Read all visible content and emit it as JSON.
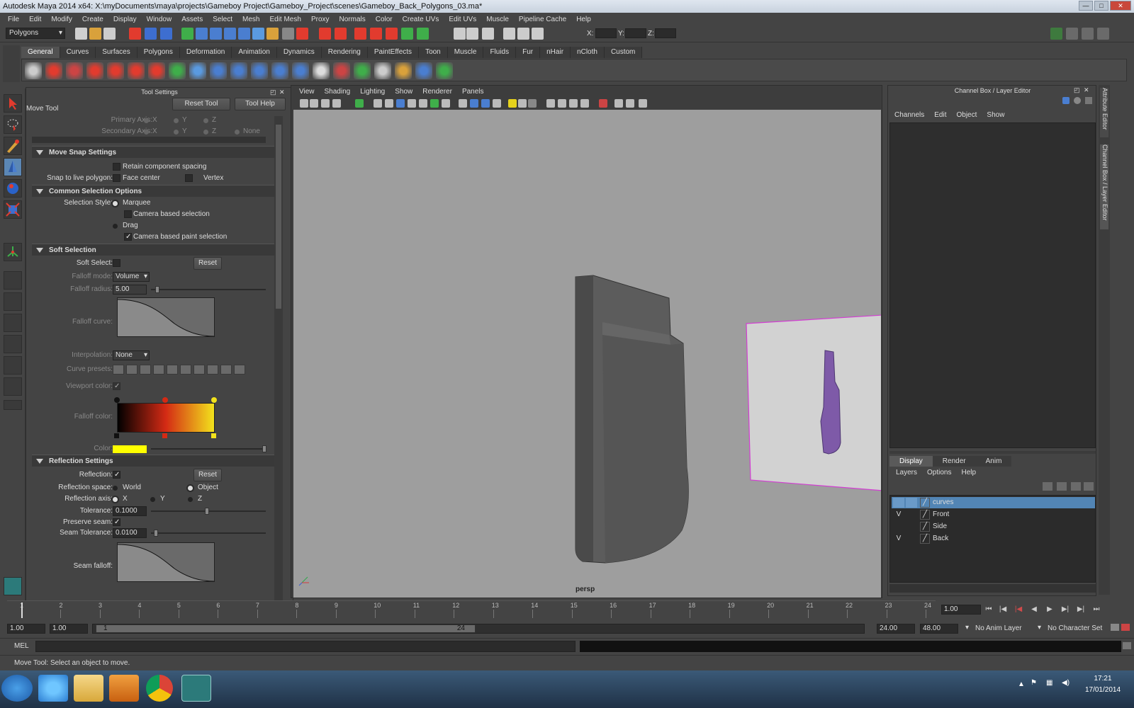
{
  "window": {
    "title": "Autodesk Maya 2014 x64: X:\\myDocuments\\maya\\projects\\Gameboy Project\\Gameboy_Project\\scenes\\Gameboy_Back_Polygons_03.ma*"
  },
  "menubar": [
    "File",
    "Edit",
    "Modify",
    "Create",
    "Display",
    "Window",
    "Assets",
    "Select",
    "Mesh",
    "Edit Mesh",
    "Proxy",
    "Normals",
    "Color",
    "Create UVs",
    "Edit UVs",
    "Muscle",
    "Pipeline Cache",
    "Help"
  ],
  "statusline": {
    "mode": "Polygons",
    "x_label": "X:",
    "y_label": "Y:",
    "z_label": "Z:"
  },
  "shelf_tabs": [
    "General",
    "Curves",
    "Surfaces",
    "Polygons",
    "Deformation",
    "Animation",
    "Dynamics",
    "Rendering",
    "PaintEffects",
    "Toon",
    "Muscle",
    "Fluids",
    "Fur",
    "nHair",
    "nCloth",
    "Custom"
  ],
  "tool_settings": {
    "panel_title": "Tool Settings",
    "tool_name": "Move Tool",
    "reset_tool": "Reset Tool",
    "tool_help": "Tool Help",
    "primary_axis": "Primary Axis:",
    "secondary_axis": "Secondary Axis:",
    "axis_x": "X",
    "axis_y": "Y",
    "axis_z": "Z",
    "axis_none": "None",
    "move_snap": {
      "title": "Move Snap Settings",
      "retain": "Retain component spacing",
      "snap_label": "Snap to live polygon:",
      "face_center": "Face center",
      "vertex": "Vertex"
    },
    "common_selection": {
      "title": "Common Selection Options",
      "style_label": "Selection Style:",
      "marquee": "Marquee",
      "camera_based": "Camera based selection",
      "drag": "Drag",
      "camera_paint": "Camera based paint selection"
    },
    "soft_selection": {
      "title": "Soft Selection",
      "soft_select": "Soft Select:",
      "reset": "Reset",
      "falloff_mode": "Falloff mode:",
      "falloff_mode_val": "Volume",
      "falloff_radius": "Falloff radius:",
      "falloff_radius_val": "5.00",
      "falloff_curve": "Falloff curve:",
      "interpolation": "Interpolation:",
      "interpolation_val": "None",
      "curve_presets": "Curve presets:",
      "viewport_color": "Viewport color:",
      "falloff_color": "Falloff color:",
      "color": "Color:"
    },
    "reflection": {
      "title": "Reflection Settings",
      "reflection": "Reflection:",
      "reset": "Reset",
      "space_label": "Reflection space:",
      "world": "World",
      "object": "Object",
      "axis_label": "Reflection axis:",
      "x": "X",
      "y": "Y",
      "z": "Z",
      "tolerance": "Tolerance:",
      "tolerance_val": "0.1000",
      "preserve_seam": "Preserve seam:",
      "seam_tolerance": "Seam Tolerance:",
      "seam_tolerance_val": "0.0100",
      "seam_falloff": "Seam falloff:"
    }
  },
  "viewport": {
    "menus": [
      "View",
      "Shading",
      "Lighting",
      "Show",
      "Renderer",
      "Panels"
    ],
    "camera": "persp"
  },
  "channel_box": {
    "title": "Channel Box / Layer Editor",
    "menus": [
      "Channels",
      "Edit",
      "Object",
      "Show"
    ]
  },
  "layer_editor": {
    "tabs": [
      "Display",
      "Render",
      "Anim"
    ],
    "menus": [
      "Layers",
      "Options",
      "Help"
    ],
    "layers": [
      {
        "v": "",
        "name": "curves"
      },
      {
        "v": "V",
        "name": "Front"
      },
      {
        "v": "",
        "name": "Side"
      },
      {
        "v": "V",
        "name": "Back"
      }
    ]
  },
  "side_tabs": [
    "Attribute Editor",
    "Channel Box / Layer Editor"
  ],
  "timeline": {
    "ticks": [
      "1",
      "2",
      "3",
      "4",
      "5",
      "6",
      "7",
      "8",
      "9",
      "10",
      "11",
      "12",
      "13",
      "14",
      "15",
      "16",
      "17",
      "18",
      "19",
      "20",
      "21",
      "22",
      "23",
      "24"
    ],
    "current": "1.00"
  },
  "range": {
    "start": "1.00",
    "start2": "1.00",
    "slider_start": "1",
    "slider_end": "24",
    "end": "24.00",
    "end2": "48.00",
    "anim_layer": "No Anim Layer",
    "char_set": "No Character Set"
  },
  "command": {
    "label": "MEL"
  },
  "help_line": "Move Tool: Select an object to move.",
  "taskbar": {
    "time": "17:21",
    "date": "17/01/2014"
  },
  "colors": {
    "accent": "#5285b5",
    "viewport_bg": "#9e9e9e",
    "falloff_start": "#000000",
    "falloff_mid": "#d42a14",
    "falloff_end": "#f2e21c",
    "color_swatch": "#ffff00",
    "wireframe": "#d23ed2",
    "model_purple": "#7e5aa8"
  }
}
